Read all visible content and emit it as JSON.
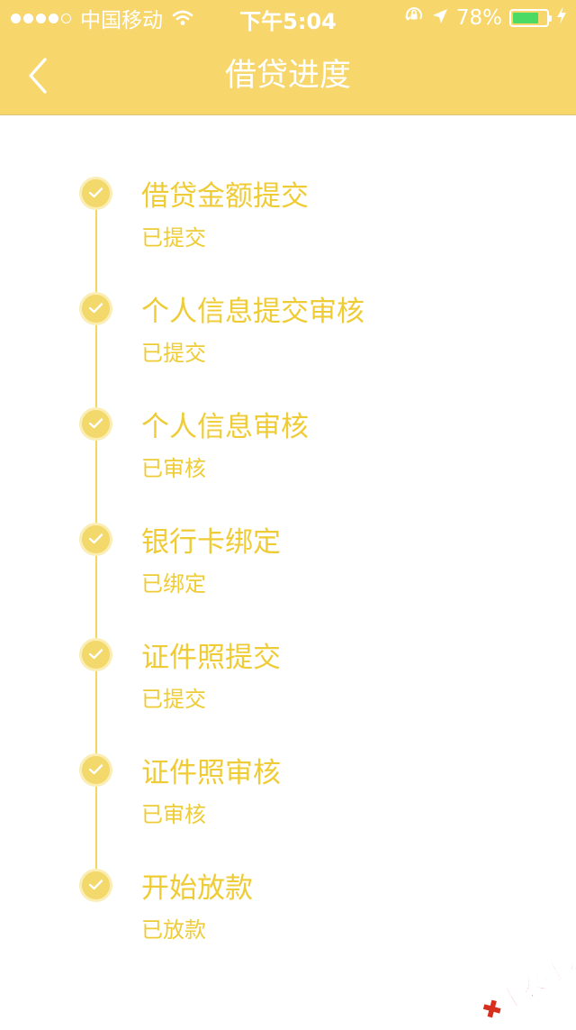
{
  "status_bar": {
    "carrier": "中国移动",
    "time": "下午5:04",
    "battery_percent": "78%",
    "battery_level": 0.78,
    "battery_color": "#4cd964"
  },
  "header": {
    "title": "借贷进度",
    "back_icon": "chevron-left-icon",
    "background_color": "#f7d66b"
  },
  "steps": [
    {
      "title": "借贷金额提交",
      "status": "已提交"
    },
    {
      "title": "个人信息提交审核",
      "status": "已提交"
    },
    {
      "title": "个人信息审核",
      "status": "已审核"
    },
    {
      "title": "银行卡绑定",
      "status": "已绑定"
    },
    {
      "title": "证件照提交",
      "status": "已提交"
    },
    {
      "title": "证件照审核",
      "status": "已审核"
    },
    {
      "title": "开始放款",
      "status": "已放款"
    }
  ],
  "accent_color": "#efcc35",
  "watermark": {
    "text": "卡农社区"
  }
}
